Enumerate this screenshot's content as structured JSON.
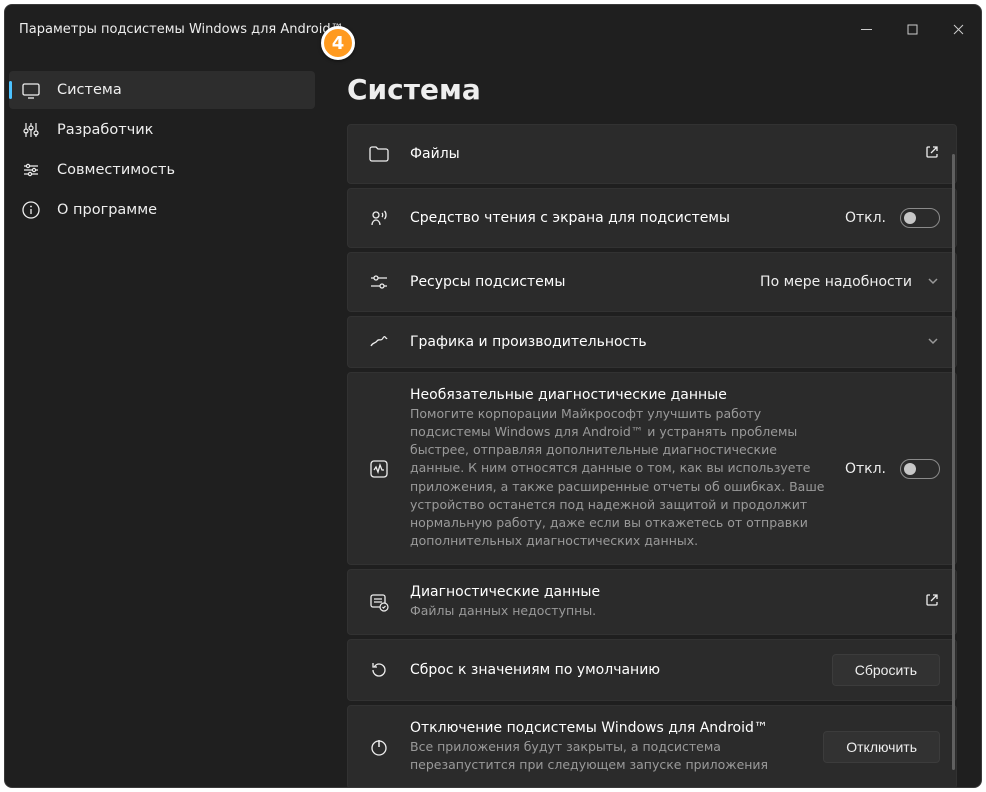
{
  "window": {
    "title": "Параметры подсистемы Windows для Android™"
  },
  "sidebar": {
    "items": [
      {
        "label": "Система"
      },
      {
        "label": "Разработчик"
      },
      {
        "label": "Совместимость"
      },
      {
        "label": "О программе"
      }
    ]
  },
  "page": {
    "title": "Система"
  },
  "cards": {
    "files": {
      "title": "Файлы"
    },
    "screen_reader": {
      "title": "Средство чтения с экрана для подсистемы",
      "status": "Откл."
    },
    "resources": {
      "title": "Ресурсы подсистемы",
      "value": "По мере надобности"
    },
    "graphics": {
      "title": "Графика и производительность"
    },
    "diag_optional": {
      "title": "Необязательные диагностические данные",
      "desc": "Помогите корпорации Майкрософт улучшить работу подсистемы Windows для Android™ и устранять проблемы быстрее, отправляя дополнительные диагностические данные. К ним относятся данные о том, как вы используете приложения, а также расширенные отчеты об ошибках. Ваше устройство останется под надежной защитой и продолжит нормальную работу, даже если вы откажетесь от отправки дополнительных диагностических данных.",
      "status": "Откл."
    },
    "diag_data": {
      "title": "Диагностические данные",
      "desc": "Файлы данных недоступны."
    },
    "reset": {
      "title": "Сброс к значениям по умолчанию",
      "button": "Сбросить"
    },
    "shutdown": {
      "title": "Отключение подсистемы Windows для Android™",
      "desc": "Все приложения будут закрыты, а подсистема перезапустится при следующем запуске приложения",
      "button": "Отключить"
    }
  },
  "annotation": {
    "number": "4"
  }
}
